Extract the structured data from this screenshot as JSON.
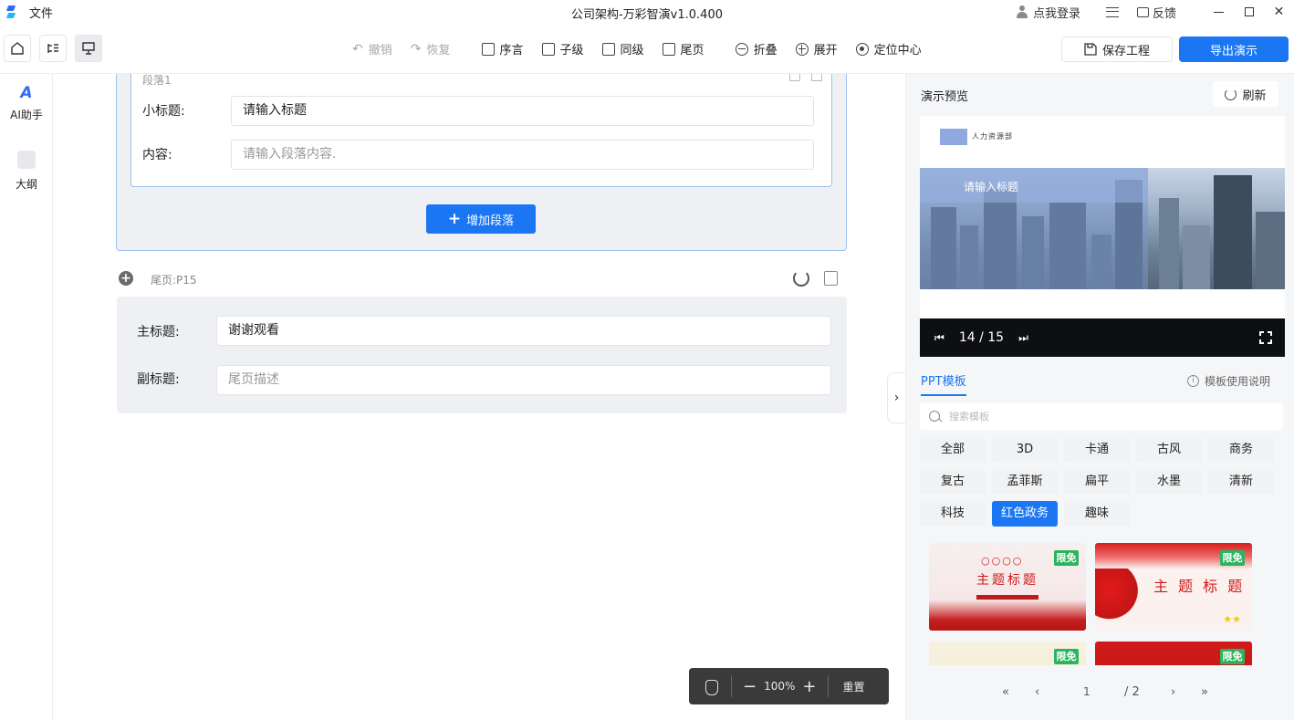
{
  "titlebar": {
    "file_menu": "文件",
    "app_title": "公司架构-万彩智演v1.0.400",
    "login": "点我登录",
    "feedback": "反馈"
  },
  "toolbar": {
    "undo": "撤销",
    "redo": "恢复",
    "preface": "序言",
    "child": "子级",
    "sibling": "同级",
    "end_page": "尾页",
    "collapse": "折叠",
    "expand": "展开",
    "locate_center": "定位中心",
    "save_project": "保存工程",
    "export_presentation": "导出演示"
  },
  "sidebar": {
    "items": [
      {
        "label": "AI助手",
        "icon": "ai-icon"
      },
      {
        "label": "大纲",
        "icon": "outline-icon"
      }
    ]
  },
  "editor": {
    "paragraph": {
      "header": "段落1",
      "subtitle_label": "小标题:",
      "subtitle_placeholder": "请输入标题",
      "content_label": "内容:",
      "content_placeholder": "请输入段落内容."
    },
    "add_paragraph": "增加段落",
    "end_page": {
      "header": "尾页:P15",
      "main_title_label": "主标题:",
      "main_title_value": "谢谢观看",
      "sub_title_label": "副标题:",
      "sub_title_placeholder": "尾页描述"
    }
  },
  "zoom": {
    "percent": "100%",
    "reset": "重置"
  },
  "preview": {
    "title": "演示预览",
    "refresh": "刷新",
    "slide_logo_text": "人力资源部",
    "slide_heading": "请输入标题",
    "page_indicator": "14 / 15"
  },
  "templates": {
    "tab_label": "PPT模板",
    "help": "模板使用说明",
    "search_placeholder": "搜索模板",
    "categories": [
      "全部",
      "3D",
      "卡通",
      "古风",
      "商务",
      "复古",
      "孟菲斯",
      "扁平",
      "水墨",
      "清新",
      "科技",
      "红色政务",
      "趣味"
    ],
    "active_category": "红色政务",
    "cards": [
      {
        "badge": "限免",
        "title": "主题标题",
        "circles": "○○○○"
      },
      {
        "badge": "限免",
        "title": "主 题 标 题"
      },
      {
        "badge": "限免"
      },
      {
        "badge": "限免"
      }
    ],
    "pager": {
      "first": "«",
      "prev": "‹",
      "current": "1",
      "total": "/ 2",
      "next": "›",
      "last": "»"
    }
  },
  "colors": {
    "accent": "#1a76f2",
    "badge_green": "#2bb45e",
    "template_red": "#d11818"
  }
}
